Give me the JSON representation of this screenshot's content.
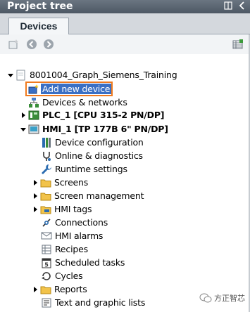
{
  "panel": {
    "title": "Project tree"
  },
  "tabs": {
    "devices": "Devices"
  },
  "tree": {
    "project": "8001004_Graph_Siemens_Training",
    "add_new_device": "Add new device",
    "devices_networks": "Devices & networks",
    "plc": "PLC_1 [CPU 315-2 PN/DP]",
    "hmi": "HMI_1 [TP 177B 6\" PN/DP]",
    "hmi_children": [
      "Device configuration",
      "Online & diagnostics",
      "Runtime settings",
      "Screens",
      "Screen management",
      "HMI tags",
      "Connections",
      "HMI alarms",
      "Recipes",
      "Scheduled tasks",
      "Cycles",
      "Reports",
      "Text and graphic lists"
    ]
  },
  "watermark": {
    "text": "方正智芯"
  },
  "colors": {
    "selection_outline": "#f07a1e",
    "selection_fill": "#3a6fc4",
    "titlebar": "#5a6571"
  }
}
